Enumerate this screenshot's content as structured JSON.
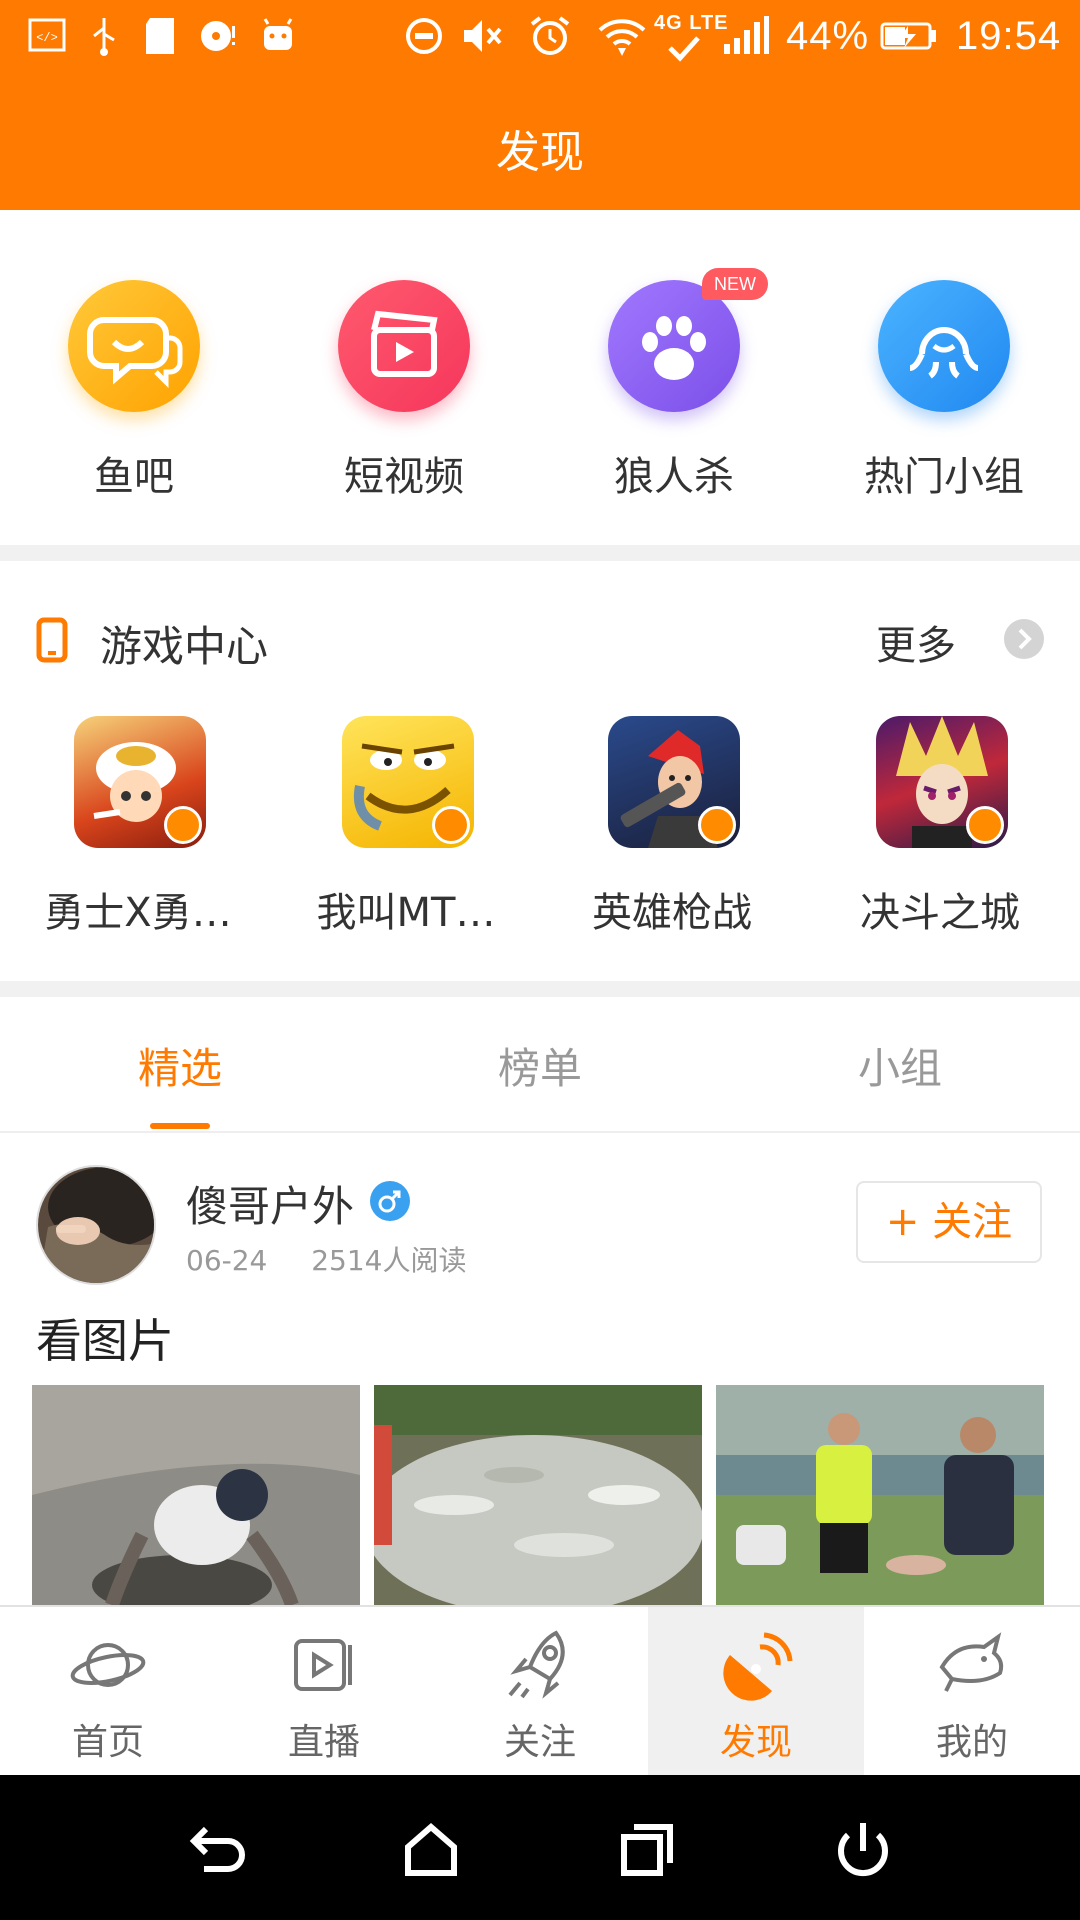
{
  "status_bar": {
    "battery": "44%",
    "time": "19:54",
    "network": "4G LTE",
    "icons": [
      "developer-icon",
      "usb-icon",
      "sd-card-icon",
      "disc-icon",
      "android-icon",
      "do-not-disturb-icon",
      "mute-icon",
      "alarm-icon",
      "wifi-icon",
      "lte-icon",
      "signal-icon",
      "battery-icon"
    ]
  },
  "header": {
    "title": "发现"
  },
  "quick_entries": [
    {
      "label": "鱼吧",
      "icon": "chat-bubbles-icon",
      "color": "#ffb300"
    },
    {
      "label": "短视频",
      "icon": "clapperboard-icon",
      "color": "#ff4a6b"
    },
    {
      "label": "狼人杀",
      "icon": "paw-icon",
      "color": "#8a5cf6",
      "badge": "NEW"
    },
    {
      "label": "热门小组",
      "icon": "octopus-icon",
      "color": "#2e9cf5"
    }
  ],
  "game_center": {
    "title": "游戏中心",
    "more_label": "更多",
    "games": [
      {
        "name": "勇士X勇…",
        "icon": "hero-game-icon"
      },
      {
        "name": "我叫MT…",
        "icon": "mt-game-icon"
      },
      {
        "name": "英雄枪战",
        "icon": "gunfight-game-icon"
      },
      {
        "name": "决斗之城",
        "icon": "duel-game-icon"
      }
    ]
  },
  "tabs": [
    {
      "label": "精选",
      "active": true
    },
    {
      "label": "榜单",
      "active": false
    },
    {
      "label": "小组",
      "active": false
    }
  ],
  "post": {
    "author": "傻哥户外",
    "date": "06-24",
    "reads": "2514人阅读",
    "follow_label": "+ 关注",
    "title": "看图片"
  },
  "bottom_nav": [
    {
      "label": "首页",
      "icon": "planet-icon",
      "active": false
    },
    {
      "label": "直播",
      "icon": "live-tv-icon",
      "active": false
    },
    {
      "label": "关注",
      "icon": "rocket-icon",
      "active": false
    },
    {
      "label": "发现",
      "icon": "discover-satellite-icon",
      "active": true
    },
    {
      "label": "我的",
      "icon": "profile-fish-icon",
      "active": false
    }
  ],
  "colors": {
    "accent": "#ff7a00",
    "text": "#333333",
    "muted": "#999999"
  }
}
